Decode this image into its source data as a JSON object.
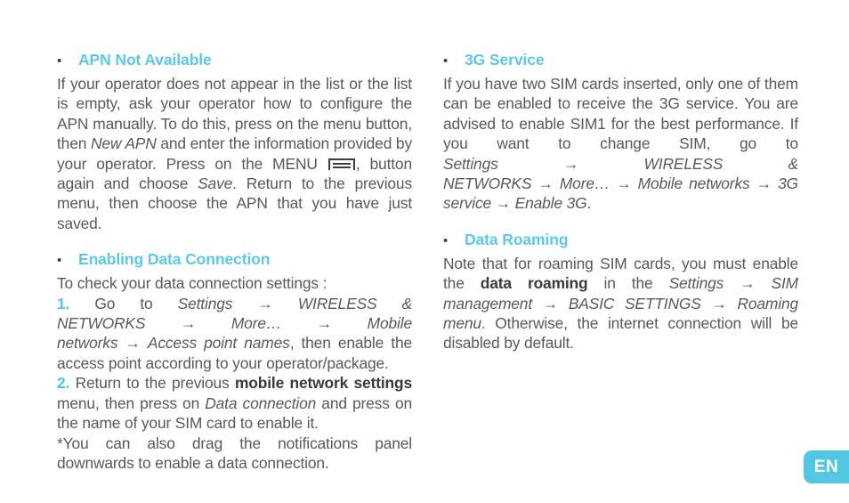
{
  "page": {
    "background_color": "#ffffff",
    "text_color": "#58595b",
    "accent_color": "#5bc8e8"
  },
  "language_badge": {
    "label": "EN",
    "background_color": "#53c6e4",
    "text_color": "#ffffff"
  },
  "left_column": {
    "sections": [
      {
        "heading": "APN Not Available",
        "bullet": "•",
        "paragraphs": {
          "p1_a": "If your operator does not appear in the list or the list is empty, ask your operator how to configure the APN manually. To do this, press on the menu button, then ",
          "p1_italic_1": "New APN",
          "p1_b": " and enter the information provided by your operator. Press on the MENU ",
          "p1_icon": "menu-button-icon",
          "p1_c": ", button again and choose ",
          "p1_italic_2": "Save",
          "p1_d": ". Return to the previous menu, then choose the APN that you have just saved."
        }
      },
      {
        "heading": "Enabling Data Connection",
        "bullet": "•",
        "paragraphs": {
          "intro": "To check your data connection settings :",
          "step1_num": "1.",
          "step1_a": " Go to ",
          "step1_path_1": "Settings",
          "step1_arrow_1": "→",
          "step1_path_2": "WIRELESS & NETWORKS",
          "step1_arrow_2": "→",
          "step1_path_3": "More…",
          "step1_arrow_3": "→",
          "step1_path_4": "Mobile networks",
          "step1_arrow_4": "→",
          "step1_path_5": "Access point names",
          "step1_b": ", then enable the access point according to your operator/package.",
          "step2_num": "2.",
          "step2_a": " Return to the previous ",
          "step2_bold": "mobile network settings",
          "step2_b": " menu, then press on ",
          "step2_italic": "Data connection",
          "step2_c": " and press on the name of your SIM card to enable it.",
          "note": "*You can also drag the notifications panel downwards to enable a data connection."
        }
      }
    ]
  },
  "right_column": {
    "sections": [
      {
        "heading": "3G Service",
        "bullet": "•",
        "paragraphs": {
          "p1_a": "If you have two SIM cards inserted, only one of them can be enabled to receive the 3G service. You are advised to enable SIM1 for the best performance. If you want to change SIM, go to ",
          "path_1": "Settings",
          "arrow_1": "→",
          "path_2": "WIRELESS & NETWORKS",
          "arrow_2": "→",
          "path_3": "More…",
          "arrow_3": "→",
          "path_4": "Mobile networks",
          "arrow_4": "→",
          "path_5": "3G service",
          "arrow_5": "→",
          "path_6": "Enable 3G",
          "p1_b": "."
        }
      },
      {
        "heading": "Data Roaming",
        "bullet": "•",
        "paragraphs": {
          "p1_a": "Note that for roaming SIM cards, you must enable the ",
          "p1_bold": "data roaming",
          "p1_b": " in the ",
          "path_1": "Settings",
          "arrow_1": "→",
          "path_2": "SIM management",
          "arrow_2": "→",
          "path_3": "BASIC SETTINGS",
          "arrow_3": "→",
          "path_4": "Roaming menu",
          "p1_c": ". Otherwise, the internet connection will be disabled by default."
        }
      }
    ]
  }
}
